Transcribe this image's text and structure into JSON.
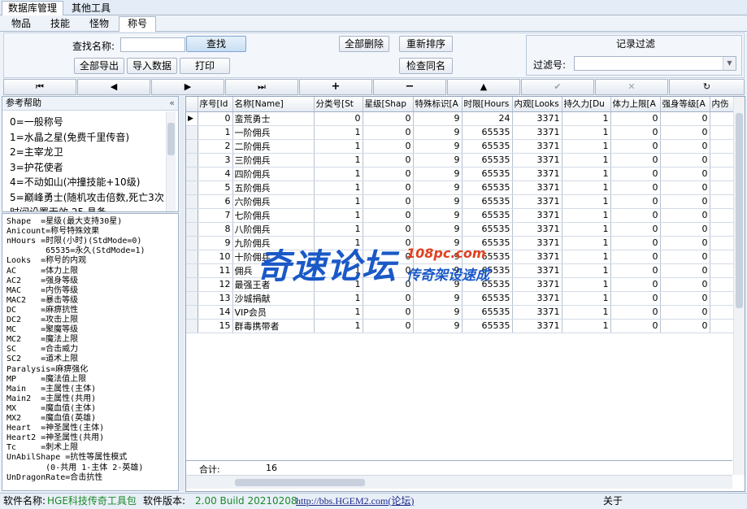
{
  "main_tabs": [
    "数据库管理",
    "其他工具"
  ],
  "sub_tabs": [
    "物品",
    "技能",
    "怪物",
    "称号"
  ],
  "toolbar": {
    "search_label": "查找名称:",
    "search_value": "",
    "find": "查找",
    "export_all": "全部导出",
    "import": "导入数据",
    "print": "打印",
    "delete_all": "全部删除",
    "resort": "重新排序",
    "check_dup": "检查同名",
    "filter_title": "记录过滤",
    "filter_label": "过滤号:",
    "filter_value": ""
  },
  "nav_icons": [
    "first-icon",
    "prior-icon",
    "next-icon",
    "last-icon",
    "insert-icon",
    "delete-icon",
    "edit-icon",
    "post-icon",
    "cancel-icon",
    "refresh-icon"
  ],
  "help": {
    "title": "参考帮助",
    "collapse": "«",
    "items": [
      "0=一般称号",
      "1=水晶之星(免费千里传音)",
      "2=主宰龙卫",
      "3=护花使者",
      "4=不动如山(冲撞技能+10级)",
      "5=巅峰勇士(随机攻击倍数,死亡3次",
      "        时间设置无效,25.具备"
    ],
    "fields": [
      "Shape  =星级(最大支持30星)",
      "Anicount=称号特殊效果",
      "nHours =时限(小时)(StdMode=0)",
      "        65535=永久(StdMode=1)",
      "Looks  =称号的内观",
      "AC     =体力上限",
      "AC2    =强身等级",
      "MAC    =内伤等级",
      "MAC2   =暴击等级",
      "DC     =麻痹抗性",
      "DC2    =攻击上限",
      "MC     =聚魔等级",
      "MC2    =魔法上限",
      "SC     =合击威力",
      "SC2    =道术上限",
      "Paralysis=麻痹强化",
      "MP     =魔法值上限",
      "Main   =主属性(主体)",
      "Main2  =主属性(共用)",
      "MX     =魔血值(主体)",
      "MX2    =魔血值(英雄)",
      "Heart  =神圣属性(主体)",
      "Heart2 =神圣属性(共用)",
      "Tc     =刺术上限",
      "UnAbilShape =抗性等属性模式",
      "        (0-共用 1-主体 2-英雄)",
      "UnDragonRate=合击抗性"
    ]
  },
  "grid": {
    "columns": [
      "序号[Id",
      "名称[Name]",
      "分类号[St",
      "星级[Shap",
      "特殊标识[A",
      "时限[Hours",
      "内观[Looks",
      "持久力[Du",
      "体力上限[A",
      "强身等级[A",
      "内伤"
    ],
    "rows": [
      [
        "0",
        "蛮荒勇士",
        "0",
        "0",
        "9",
        "24",
        "3371",
        "1",
        "0",
        "0",
        ""
      ],
      [
        "1",
        "一阶佣兵",
        "1",
        "0",
        "9",
        "65535",
        "3371",
        "1",
        "0",
        "0",
        ""
      ],
      [
        "2",
        "二阶佣兵",
        "1",
        "0",
        "9",
        "65535",
        "3371",
        "1",
        "0",
        "0",
        ""
      ],
      [
        "3",
        "三阶佣兵",
        "1",
        "0",
        "9",
        "65535",
        "3371",
        "1",
        "0",
        "0",
        ""
      ],
      [
        "4",
        "四阶佣兵",
        "1",
        "0",
        "9",
        "65535",
        "3371",
        "1",
        "0",
        "0",
        ""
      ],
      [
        "5",
        "五阶佣兵",
        "1",
        "0",
        "9",
        "65535",
        "3371",
        "1",
        "0",
        "0",
        ""
      ],
      [
        "6",
        "六阶佣兵",
        "1",
        "0",
        "9",
        "65535",
        "3371",
        "1",
        "0",
        "0",
        ""
      ],
      [
        "7",
        "七阶佣兵",
        "1",
        "0",
        "9",
        "65535",
        "3371",
        "1",
        "0",
        "0",
        ""
      ],
      [
        "8",
        "八阶佣兵",
        "1",
        "0",
        "9",
        "65535",
        "3371",
        "1",
        "0",
        "0",
        ""
      ],
      [
        "9",
        "九阶佣兵",
        "1",
        "0",
        "9",
        "65535",
        "3371",
        "1",
        "0",
        "0",
        ""
      ],
      [
        "10",
        "十阶佣兵",
        "1",
        "0",
        "9",
        "65535",
        "3371",
        "1",
        "0",
        "0",
        ""
      ],
      [
        "11",
        "佣兵",
        "1",
        "0",
        "9",
        "65535",
        "3371",
        "1",
        "0",
        "0",
        ""
      ],
      [
        "12",
        "最强王者",
        "1",
        "0",
        "9",
        "65535",
        "3371",
        "1",
        "0",
        "0",
        ""
      ],
      [
        "13",
        "沙城捐献",
        "1",
        "0",
        "9",
        "65535",
        "3371",
        "1",
        "0",
        "0",
        ""
      ],
      [
        "14",
        "VIP会员",
        "1",
        "0",
        "9",
        "65535",
        "3371",
        "1",
        "0",
        "0",
        ""
      ],
      [
        "15",
        "群毒携带者",
        "1",
        "0",
        "9",
        "65535",
        "3371",
        "1",
        "0",
        "0",
        ""
      ]
    ],
    "total_label": "合计:",
    "total_value": "16"
  },
  "watermark": {
    "main": "奇速论坛",
    "site": "108pc.com",
    "sub": "传奇架设速成"
  },
  "status": {
    "name_label": "软件名称:",
    "name_value": "HGE科技传奇工具包",
    "version_label": "软件版本:",
    "version_value": "2.00 Build 20210208",
    "link": "http://bbs.HGEM2.com(论坛)",
    "about": "关于"
  },
  "colors": {
    "status_value": "#1a8a2a",
    "watermark_blue": "#1a59c7",
    "watermark_red": "#e0401f"
  }
}
